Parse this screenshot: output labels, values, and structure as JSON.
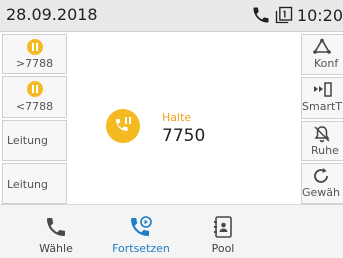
{
  "statusbar": {
    "date": "28.09.2018",
    "time": "10:20"
  },
  "left_lines": [
    {
      "label": ">7788",
      "status": "hold"
    },
    {
      "label": "<7788",
      "status": "hold"
    },
    {
      "label": "Leitung"
    },
    {
      "label": "Leitung"
    }
  ],
  "call": {
    "status": "Halte",
    "number": "7750"
  },
  "right_functions": [
    {
      "label": "Konf",
      "icon": "conference-icon"
    },
    {
      "label": "SmartT",
      "icon": "smart-transfer-icon"
    },
    {
      "label": "Ruhe",
      "icon": "mute-bell-icon"
    },
    {
      "label": "Gewäh",
      "icon": "redial-icon"
    }
  ],
  "bottom_tabs": [
    {
      "label": "Wähle",
      "icon": "phone-icon"
    },
    {
      "label": "Fortsetzen",
      "icon": "resume-call-icon",
      "active": true
    },
    {
      "label": "Pool",
      "icon": "contact-card-icon"
    }
  ],
  "colors": {
    "accent_orange": "#f5b921",
    "accent_blue": "#1b7fc4"
  }
}
